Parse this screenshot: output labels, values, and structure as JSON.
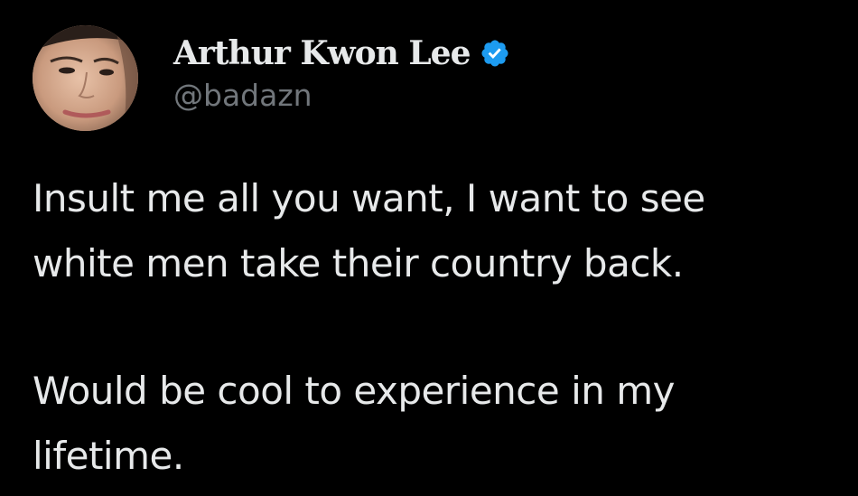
{
  "author": {
    "display_name": "Arthur Kwon Lee",
    "handle": "@badazn",
    "verified": true,
    "verified_icon": "verified-badge-icon",
    "verified_color": "#1d9bf0"
  },
  "tweet": {
    "paragraphs": [
      [
        "Insult me all you want, I want to see",
        "white men take their country back."
      ],
      [
        "Would be cool to experience in my",
        "lifetime."
      ]
    ]
  },
  "colors": {
    "background": "#000000",
    "text_primary": "#e7e9ea",
    "text_secondary": "#71767b"
  }
}
